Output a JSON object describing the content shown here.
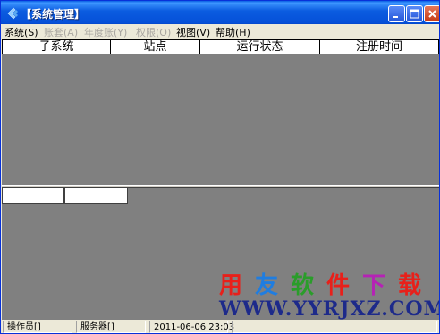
{
  "window": {
    "title": "【系统管理】"
  },
  "menu": [
    {
      "label": "系统(S)",
      "enabled": true
    },
    {
      "label": "账套(A)",
      "enabled": false
    },
    {
      "label": "年度账(Y)",
      "enabled": false
    },
    {
      "label": "权限(O)",
      "enabled": false
    },
    {
      "label": "视图(V)",
      "enabled": true
    },
    {
      "label": "帮助(H)",
      "enabled": true
    }
  ],
  "grid": {
    "columns": [
      "子系统",
      "站点",
      "运行状态",
      "注册时间"
    ]
  },
  "watermark": {
    "chars": [
      "用",
      "友",
      "软",
      "件",
      "下",
      "载"
    ],
    "colors": [
      "#e8201a",
      "#1f7de0",
      "#2a9d2a",
      "#e8201a",
      "#b522b5",
      "#e8201a"
    ],
    "url": "WWW.YYRJXZ.COM"
  },
  "status": {
    "operator": "操作员[]",
    "server": "服务器[]",
    "datetime": "2011-06-06 23:03"
  },
  "colors": {
    "titlebar": "#0550d8",
    "pane": "#808080",
    "menubar": "#ece9d8"
  }
}
